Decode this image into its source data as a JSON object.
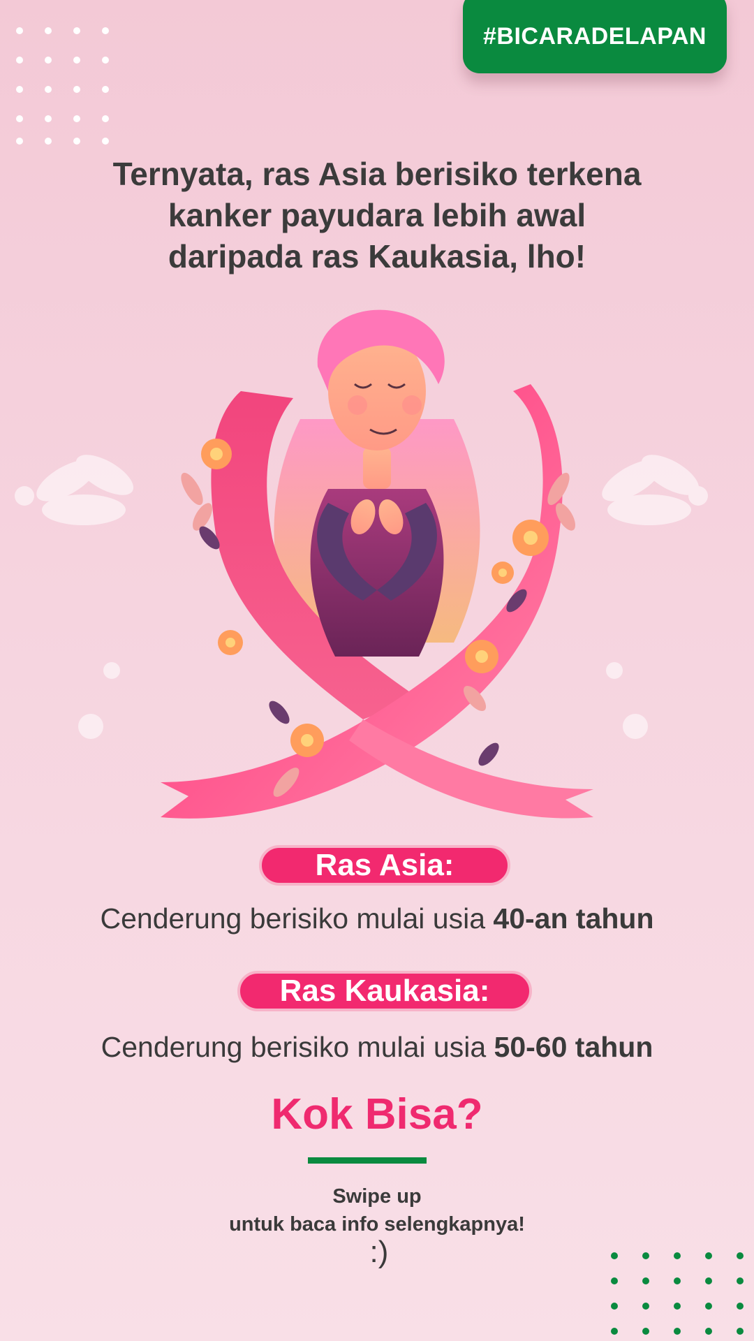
{
  "hashtag": "#BICARADELAPAN",
  "headline": {
    "line1": "Ternyata, ras Asia berisiko terkena",
    "line2": "kanker payudara lebih awal",
    "line3": "daripada ras Kaukasia, lho!"
  },
  "illustration": {
    "icon": "pink-ribbon-woman-illustration"
  },
  "asia": {
    "label": "Ras Asia:",
    "text": "Cenderung berisiko mulai usia",
    "age": "40-an tahun"
  },
  "kaukasia": {
    "label": "Ras Kaukasia:",
    "text": "Cenderung berisiko mulai usia",
    "age": "50-60 tahun"
  },
  "cta": {
    "title": "Kok Bisa?",
    "line1": "Swipe up",
    "line2": "untuk baca info selengkapnya!",
    "smile": ":)"
  },
  "colors": {
    "brand_green": "#0a8a3f",
    "accent_pink": "#ef2a6f",
    "background": "#f6d4df"
  }
}
